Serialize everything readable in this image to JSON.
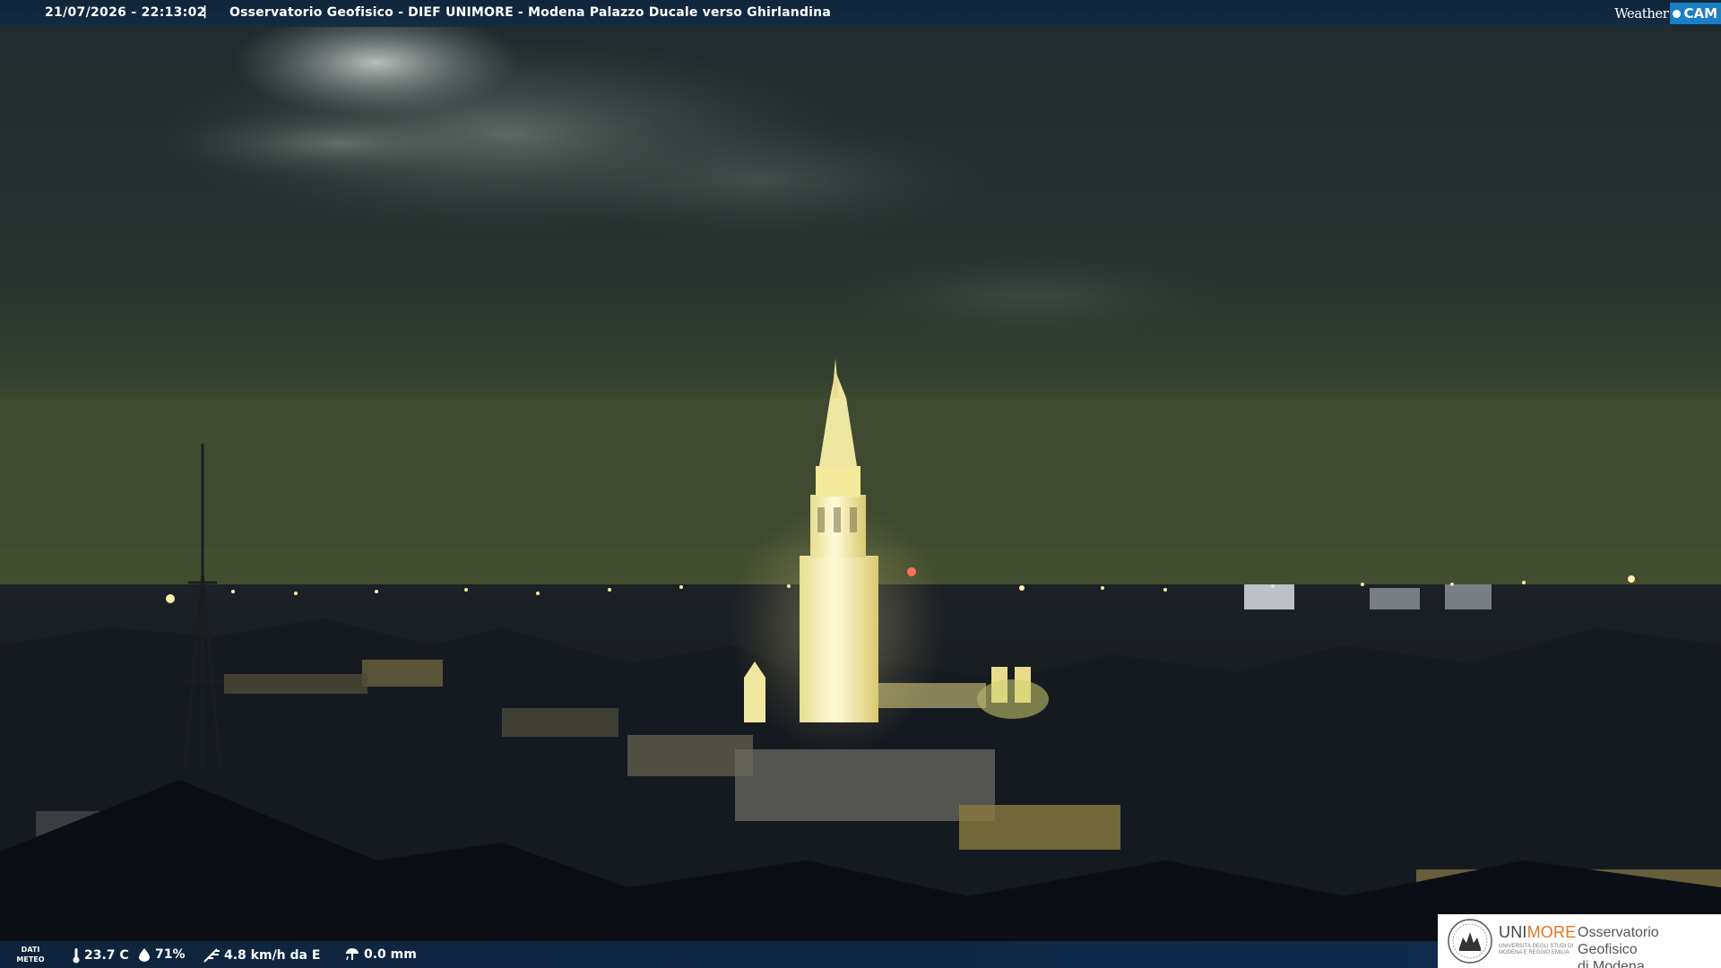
{
  "header": {
    "datetime": "21/07/2026 - 22:13:02",
    "separator": "|",
    "title": "Osservatorio Geofisico - DIEF UNIMORE - Modena Palazzo Ducale verso Ghirlandina",
    "brand_weather": "Weather",
    "brand_cam": "CAM"
  },
  "weather_bar": {
    "dati_meteo_line1": "DATI",
    "dati_meteo_line2": "METEO",
    "temperature": "23.7 C",
    "humidity": "71%",
    "wind": "4.8 km/h da E",
    "rain": "0.0 mm",
    "icons": [
      "thermometer-icon",
      "humidity-drop-icon",
      "wind-icon",
      "rain-gauge-icon"
    ]
  },
  "logo": {
    "uni_part1": "UNI",
    "uni_part2": "MORE",
    "uni_subtitle": "UNIVERSITÀ DEGLI STUDI DI MODENA E REGGIO EMILIA",
    "observatory_line1": "Osservatorio Geofisico",
    "observatory_line2": "di Modena"
  },
  "colors": {
    "bar_blue": "#0e253c",
    "brand_blue": "#1a7fc4",
    "unimore_orange": "#e47722",
    "sky": "#2a3a36",
    "tower_light": "#fff3a8"
  }
}
